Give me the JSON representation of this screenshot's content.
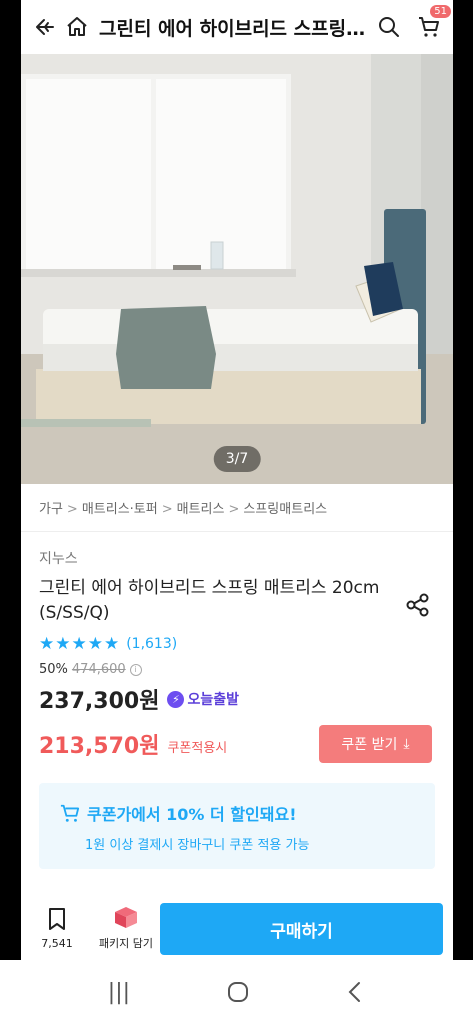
{
  "header": {
    "title": "그린티 에어 하이브리드 스프링 매트리스 20cm (S/SS/Q)",
    "cart_count": "51"
  },
  "gallery": {
    "pager": "3/7"
  },
  "breadcrumb": [
    "가구",
    "매트리스·토퍼",
    "매트리스",
    "스프링매트리스"
  ],
  "product": {
    "brand": "지누스",
    "name": "그린티 에어 하이브리드 스프링 매트리스 20cm (S/SS/Q)",
    "rating": 5,
    "review_count": "(1,613)",
    "discount_rate": "50%",
    "original_price": "474,600",
    "price": "237,300원",
    "shipping_badge": "오늘출발",
    "coupon_price": "213,570원",
    "coupon_note": "쿠폰적용시",
    "coupon_button": "쿠폰 받기"
  },
  "promo": {
    "title": "쿠폰가에서 10% 더 할인돼요!",
    "subtitle": "1원 이상 결제시 장바구니 쿠폰 적용 가능"
  },
  "bottom_bar": {
    "bookmark_count": "7,541",
    "package_label": "패키지 담기",
    "buy_label": "구매하기"
  },
  "colors": {
    "accent": "#1ea8f5",
    "coupon": "#f05a5a",
    "badge": "#6d4ef0"
  }
}
